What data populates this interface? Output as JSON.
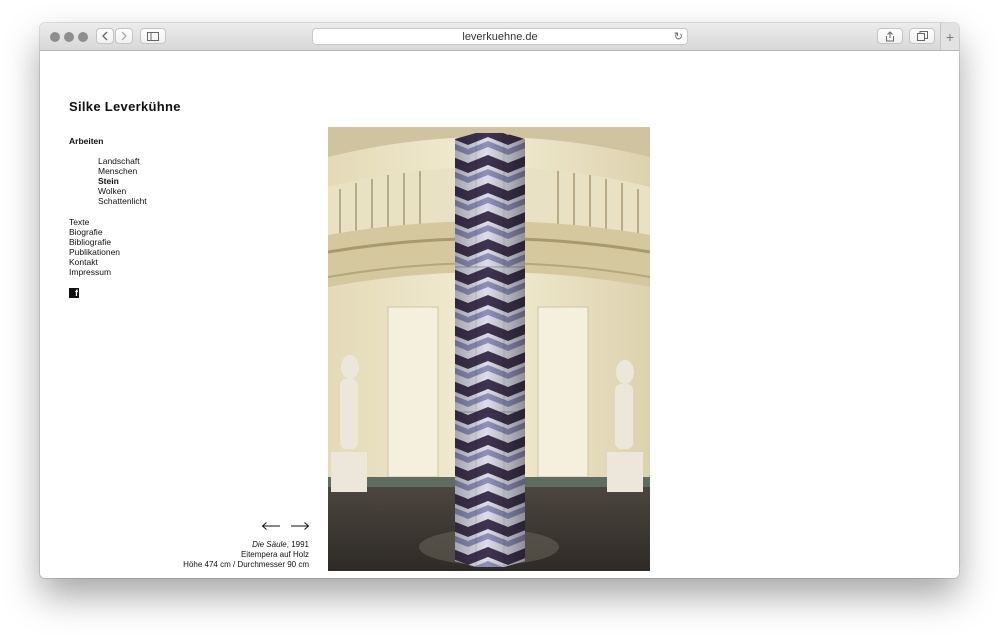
{
  "browser": {
    "url": "leverkuehne.de"
  },
  "site": {
    "title": "Silke Leverkühne",
    "nav_heading": "Arbeiten",
    "subnav": [
      {
        "label": "Landschaft",
        "active": false
      },
      {
        "label": "Menschen",
        "active": false
      },
      {
        "label": "Stein",
        "active": true
      },
      {
        "label": "Wolken",
        "active": false
      },
      {
        "label": "Schattenlicht",
        "active": false
      }
    ],
    "mainnav": [
      "Texte",
      "Biografie",
      "Bibliografie",
      "Publikationen",
      "Kontakt",
      "Impressum"
    ],
    "social_icon": "facebook-icon"
  },
  "artwork": {
    "title": "Die Säule",
    "year": ", 1991",
    "medium": "Eitempera auf Holz",
    "dimensions": "Höhe 474 cm / Durchmesser 90 cm"
  },
  "colors": {
    "background": "#ffffff",
    "text": "#111111",
    "column_dark": "#3f3450",
    "column_mid": "#8f8fb8",
    "column_light": "#dcdde8"
  }
}
